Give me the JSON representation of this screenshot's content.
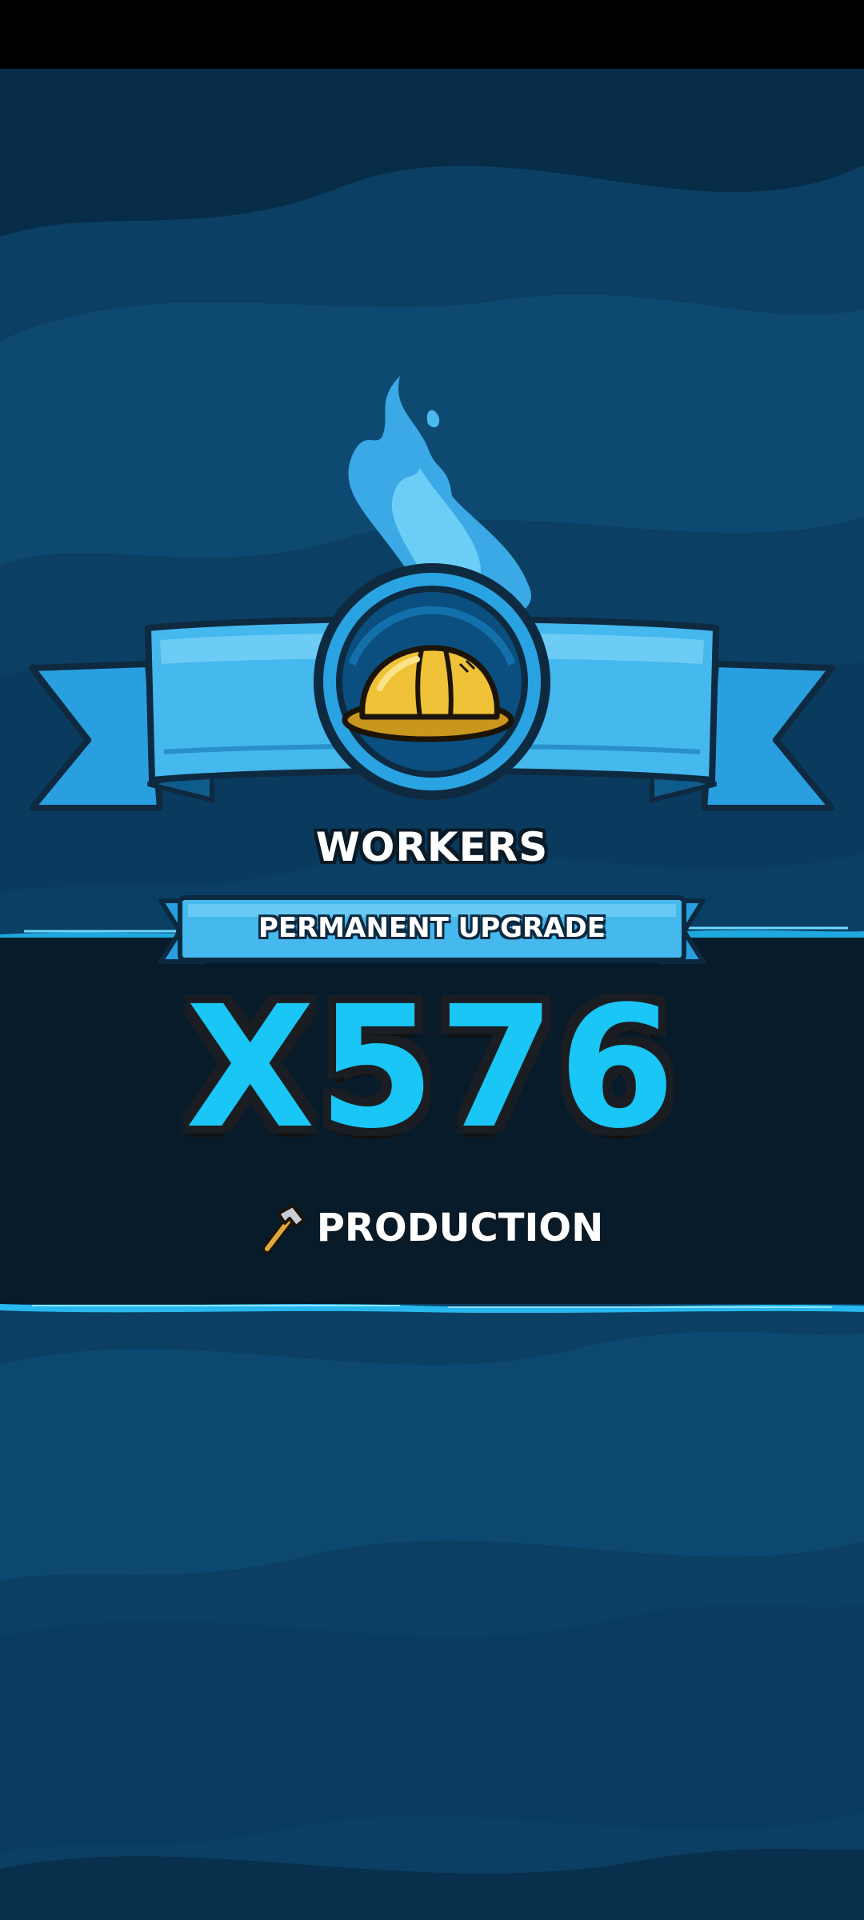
{
  "reward": {
    "category": "WORKERS",
    "badge": "PERMANENT UPGRADE",
    "multiplier": "X576",
    "stat_label": "PRODUCTION",
    "main_icon": "hard-hat-icon",
    "stat_icon": "hammer-icon"
  },
  "colors": {
    "background": "#0b3f63",
    "band": "#081b2b",
    "accent": "#19c6f5",
    "ribbon": "#3ab4ec",
    "helmet": "#f0c237"
  }
}
